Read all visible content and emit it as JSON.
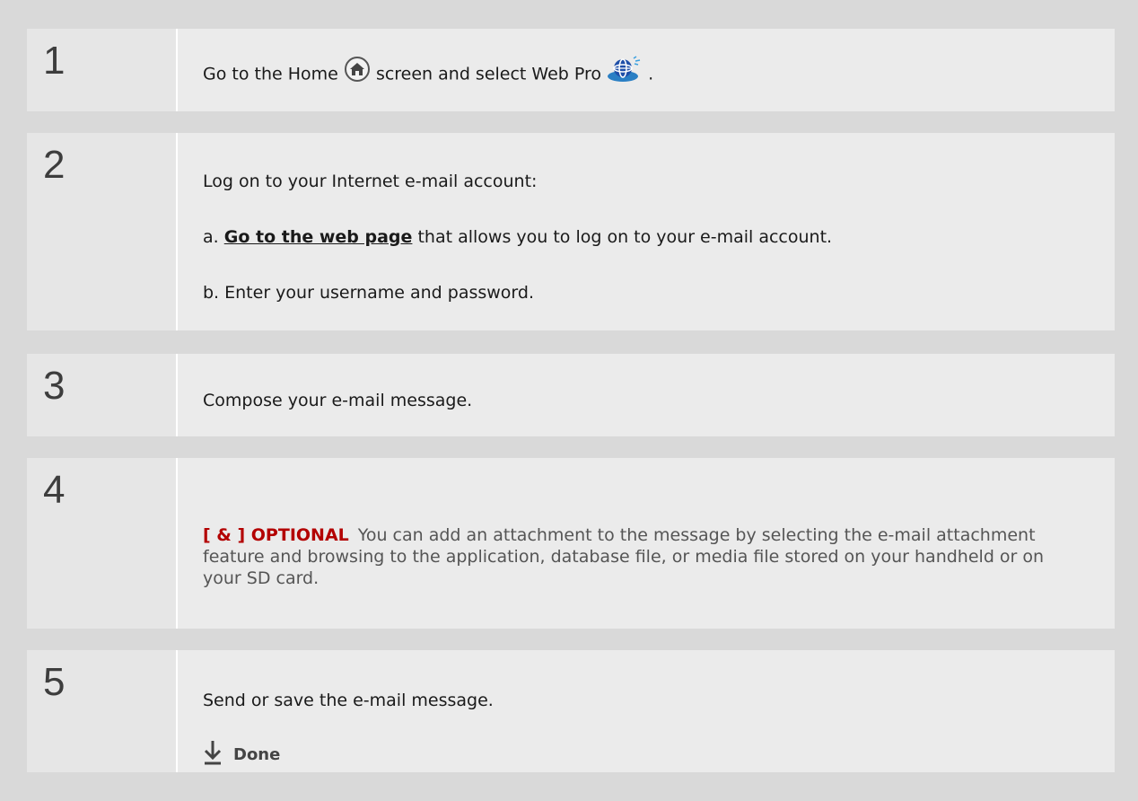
{
  "steps": [
    {
      "number": "1",
      "text_before": "Go to the Home",
      "text_middle": "screen and select Web Pro",
      "text_after": "."
    },
    {
      "number": "2",
      "intro": "Log on to your Internet e-mail account:",
      "sub_a_prefix": "a.",
      "sub_a_link": "Go to the web page",
      "sub_a_rest": "that allows you to log on to your e-mail account.",
      "sub_b": "b. Enter your username and password."
    },
    {
      "number": "3",
      "text": "Compose your e-mail message."
    },
    {
      "number": "4",
      "tag": "[ & ] OPTIONAL",
      "text": "You can add an attachment to the message by selecting the e-mail attachment feature and browsing to the application, database file, or media file stored on your handheld or on your SD card."
    },
    {
      "number": "5",
      "text": "Send or save the e-mail message.",
      "done_label": "Done"
    }
  ],
  "icons": {
    "home": "home-icon",
    "web_pro": "web-pro-globe-icon",
    "done": "down-arrow-done-icon"
  },
  "colors": {
    "background": "#d9d9d9",
    "cell": "#ebebeb",
    "optional": "#b30000"
  }
}
